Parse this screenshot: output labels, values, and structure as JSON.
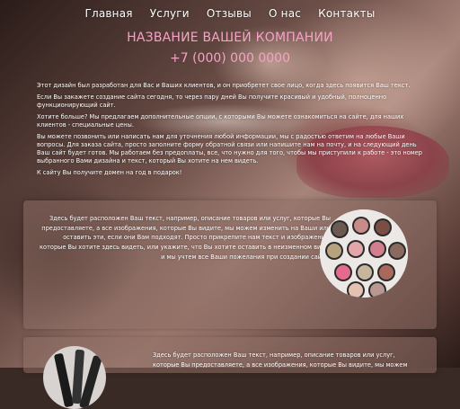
{
  "nav": {
    "items": [
      "Главная",
      "Услуги",
      "Отзывы",
      "О нас",
      "Контакты"
    ]
  },
  "header": {
    "company_name": "НАЗВАНИЕ ВАШЕЙ КОМПАНИИ",
    "phone": "+7 (000) 000 0000"
  },
  "intro": {
    "paragraphs": [
      "Этот дизайн был разработан для Вас и Ваших клиентов, и он приобретет свое лицо, когда здесь появится Ваш текст.",
      "Если Вы закажете создание сайта сегодня, то через пару дней Вы получите красивый и удобный, полноценно функционирующий сайт.",
      "Хотите больше? Мы предлагаем дополнительные опции, с которыми Вы можете ознакомиться на сайте, для наших клиентов - специальные цены.",
      "Вы можете позвонить или написать нам для уточнения любой информации, мы с радостью ответим на любые Ваши вопросы. Для заказа сайта, просто заполните форму обратной связи или напишите нам на почту, и на следующий день Ваш сайт будет готов. Мы работаем без предоплаты, все, что нужно для того, чтобы мы приступили к работе - это номер выбранного Вами дизайна и текст, который Вы хотите на нем видеть.",
      "К сайту Вы получите домен на год в подарок!"
    ]
  },
  "cards": [
    {
      "text": "Здесь будет расположен Ваш текст, например, описание товаров или услуг, которые Вы предоставляете, а все изображения, которые Вы видите, мы можем изменить на Ваши или оставить эти, если они Вам подходят. Просто прикрепите нам текст и изображения, которые Вы хотите здесь видеть, или укажите, что Вы хотите оставить в неизменном виде, и мы учтем все Ваши пожелания при создании сайта.",
      "image_icon": "eyeshadow-palette-icon"
    },
    {
      "text": "Здесь будет расположен Ваш текст, например, описание товаров или услуг, которые Вы предоставляете, а все изображения, которые Вы видите, мы можем",
      "image_icon": "makeup-brushes-icon"
    }
  ],
  "colors": {
    "accent": "#f4a3c4",
    "text": "#ffffff"
  }
}
